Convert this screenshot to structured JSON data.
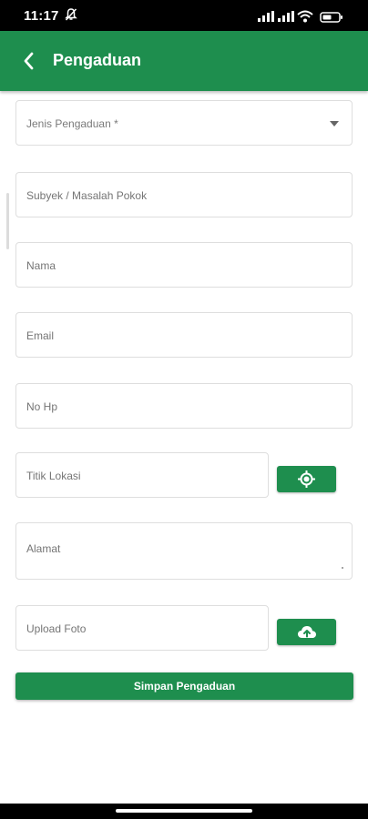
{
  "status_bar": {
    "time": "11:17",
    "icons": [
      "dnd-off-icon",
      "signal-icon",
      "signal-icon",
      "wifi-icon",
      "battery-icon"
    ]
  },
  "app_bar": {
    "title": "Pengaduan",
    "back_icon": "chevron-left-icon",
    "background_color": "#1e8e4e"
  },
  "form": {
    "complaint_type": {
      "placeholder": "Jenis Pengaduan *",
      "value": ""
    },
    "subject": {
      "placeholder": "Subyek / Masalah Pokok",
      "value": ""
    },
    "name": {
      "placeholder": "Nama",
      "value": ""
    },
    "email": {
      "placeholder": "Email",
      "value": ""
    },
    "phone": {
      "placeholder": "No Hp",
      "value": ""
    },
    "location": {
      "placeholder": "Titik Lokasi",
      "value": "",
      "action_icon": "gps-location-icon"
    },
    "address": {
      "placeholder": "Alamat",
      "value": ""
    },
    "photo": {
      "placeholder": "Upload Foto",
      "value": "",
      "action_icon": "cloud-upload-icon"
    },
    "submit_label": "Simpan Pengaduan"
  },
  "colors": {
    "primary": "#1e8e4e",
    "field_border": "#dedede",
    "placeholder_text": "#7a7a7a"
  }
}
